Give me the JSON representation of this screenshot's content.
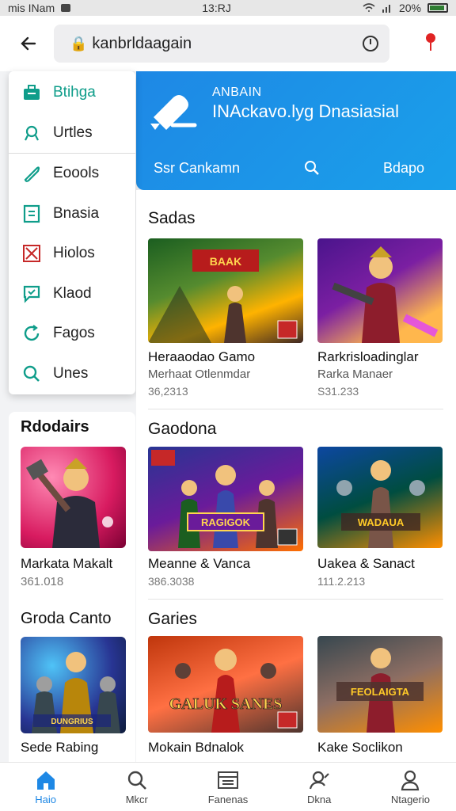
{
  "status_bar": {
    "left_text": "mis INam",
    "time": "13:RJ",
    "battery": "20%"
  },
  "top_bar": {
    "search_lead": "🔒",
    "search_text": "kanbrldaagain"
  },
  "banner": {
    "title_line1": "ANBAIN",
    "title_line2": "INAckavo.lyg Dnasiasial",
    "left_link": "Ssr Cankamn",
    "right_link": "Bdapo",
    "accent": "#1e88e5"
  },
  "menu": {
    "items": [
      {
        "label": "Btihga",
        "icon": "briefcase-icon",
        "active": true
      },
      {
        "label": "Urtles",
        "icon": "medal-icon"
      },
      {
        "label": "Eoools",
        "icon": "tag-icon"
      },
      {
        "label": "Bnasia",
        "icon": "document-icon"
      },
      {
        "label": "Hiolos",
        "icon": "close-box-icon"
      },
      {
        "label": "Klaod",
        "icon": "chat-icon"
      },
      {
        "label": "Fagos",
        "icon": "refresh-icon"
      },
      {
        "label": "Unes",
        "icon": "search-icon"
      }
    ]
  },
  "side": {
    "heading1": "Rdodairs",
    "card1_title": "Markata Makalt",
    "card1_meta": "361.018",
    "heading2": "Groda Canto",
    "card2_title": "Sede Rabing",
    "card2_art_text": "DUNGRIUS"
  },
  "sections": [
    {
      "title": "Sadas",
      "cards": [
        {
          "title": "Heraaodao Gamo",
          "sub": "Merhaat Otlenmdar",
          "meta": "36,2313",
          "art_text": "BAAK"
        },
        {
          "title": "Rarkrisloadinglar",
          "sub": "Rarka Manaer",
          "meta": "S31.233"
        }
      ]
    },
    {
      "title": "Gaodona",
      "cards": [
        {
          "title": "Meanne & Vanca",
          "meta": "386.3038",
          "art_text": "RAGIGOK"
        },
        {
          "title": "Uakea & Sanact",
          "meta": "111.2.213",
          "art_text": "WADAUA"
        }
      ]
    },
    {
      "title": "Garies",
      "cards": [
        {
          "title": "Mokain Bdnalok",
          "art_text": "GALUK SANES"
        },
        {
          "title": "Kake Soclikon",
          "art_text": "FEOLAIGTA"
        }
      ]
    }
  ],
  "bottom_nav": [
    {
      "label": "Haio",
      "icon": "home-icon",
      "active": true
    },
    {
      "label": "Mkcr",
      "icon": "search-icon"
    },
    {
      "label": "Fanenas",
      "icon": "list-icon"
    },
    {
      "label": "Dkna",
      "icon": "person-search-icon"
    },
    {
      "label": "Ntagerio",
      "icon": "profile-icon"
    }
  ]
}
